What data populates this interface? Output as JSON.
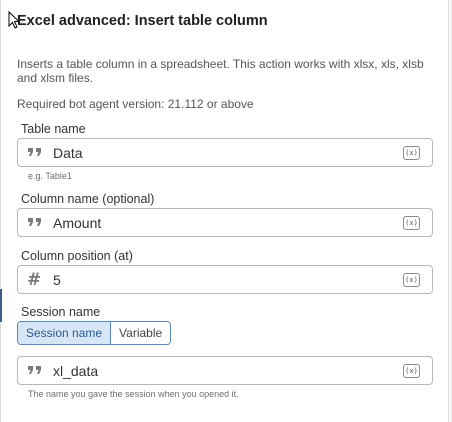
{
  "panel": {
    "title": "Excel advanced: Insert table column",
    "description": "Inserts a table column in a spreadsheet. This action works with xlsx, xls, xlsb and xlsm files.",
    "required_version": "Required bot agent version: 21.112 or above"
  },
  "fields": {
    "table_name": {
      "label": "Table name",
      "value": "Data",
      "hint": "e.g. Table1",
      "prefix_icon": "quote-icon",
      "var_button": "(x)"
    },
    "column_name": {
      "label": "Column name (optional)",
      "value": "Amount",
      "prefix_icon": "quote-icon",
      "var_button": "(x)"
    },
    "column_position": {
      "label": "Column position (at)",
      "value": "5",
      "prefix_icon": "hash-icon",
      "prefix": "#",
      "var_button": "(x)"
    },
    "session": {
      "label": "Session name",
      "options": [
        "Session name",
        "Variable"
      ],
      "selected": "Session name",
      "value": "xl_data",
      "hint": "The name you gave the session when you opened it.",
      "prefix_icon": "quote-icon",
      "var_button": "(x)"
    }
  },
  "colors": {
    "accent": "#5b86b8",
    "accent_bg": "#d6e6f7",
    "border": "#b8b8b8"
  }
}
